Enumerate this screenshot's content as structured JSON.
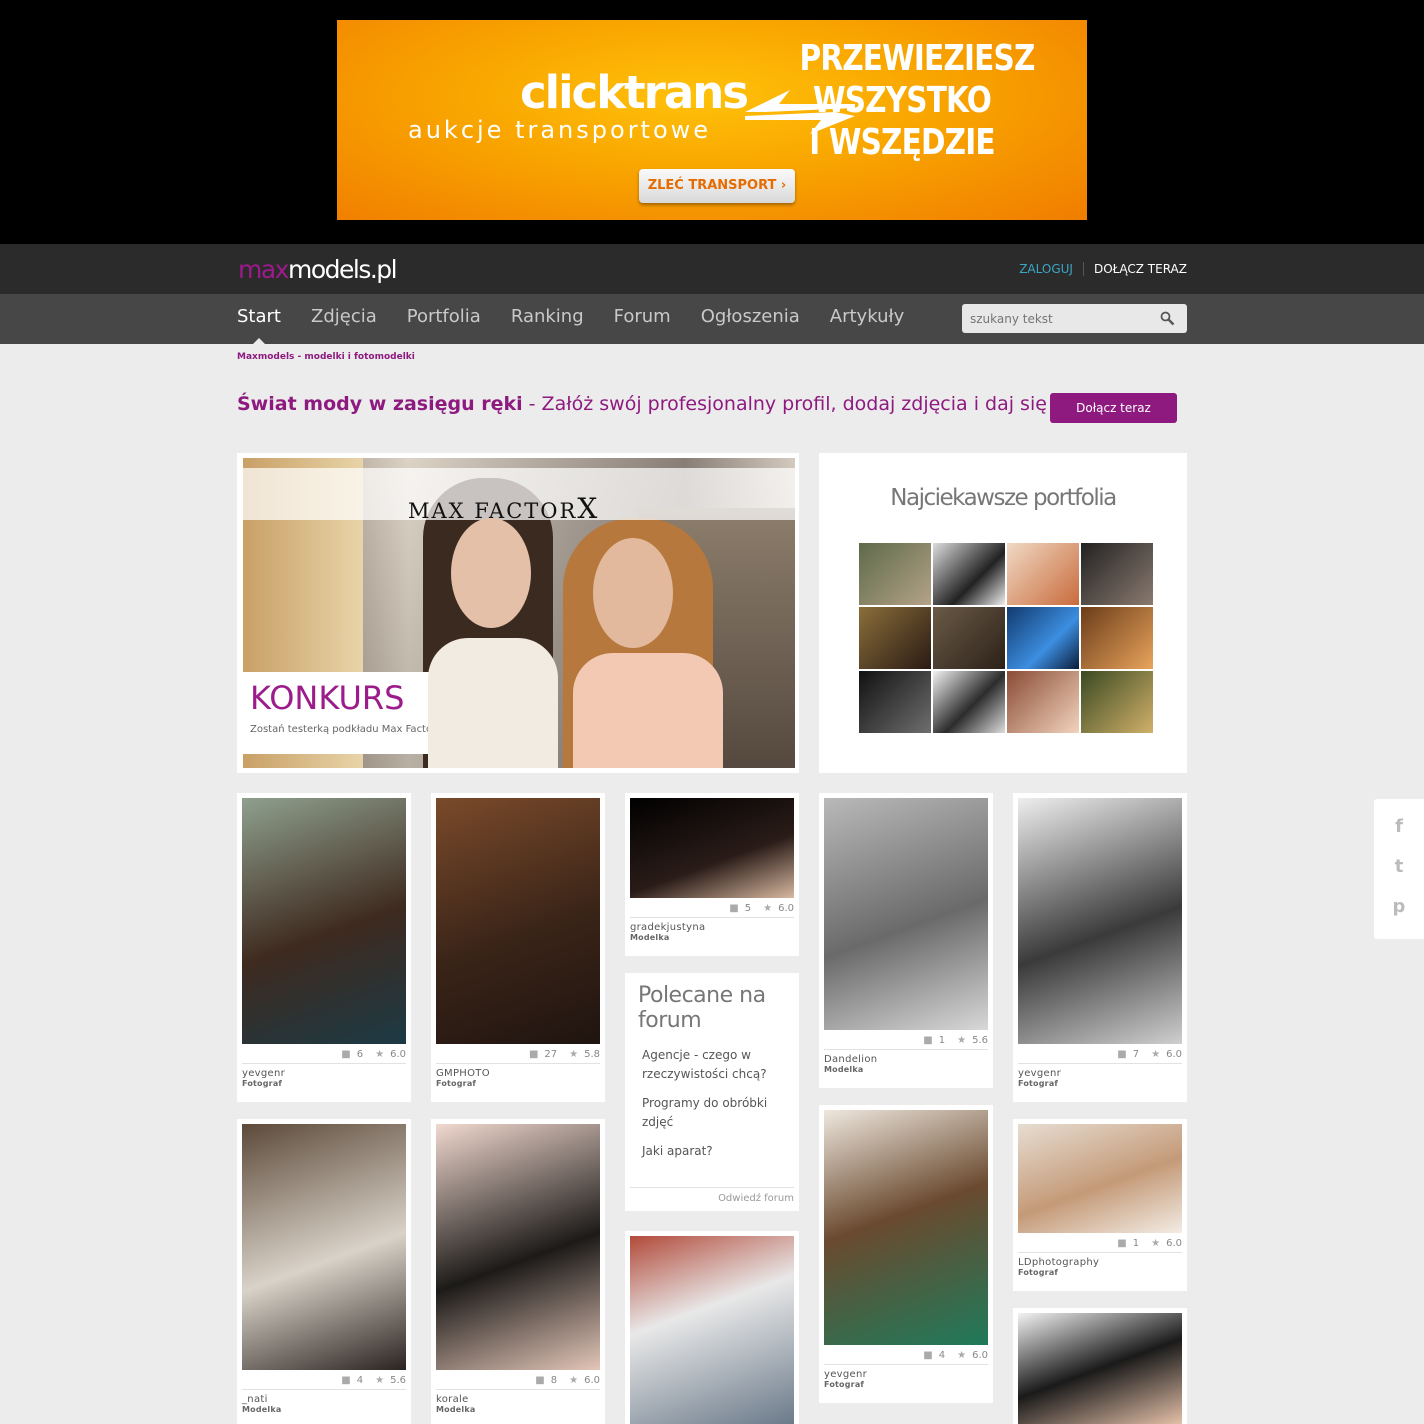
{
  "ad": {
    "brand": "clicktrans",
    "subtitle": "aukcje transportowe",
    "headline_1": "PRZEWIEZIESZ",
    "headline_2": "WSZYSTKO",
    "headline_3": "I WSZĘDZIE",
    "button": "ZLEĆ TRANSPORT ›",
    "color_bg": "#f9a600"
  },
  "header": {
    "logo_max": "max",
    "logo_rest": "models.pl",
    "login": "ZALOGUJ",
    "join": "DOŁĄCZ TERAZ"
  },
  "nav": {
    "items": [
      "Start",
      "Zdjęcia",
      "Portfolia",
      "Ranking",
      "Forum",
      "Ogłoszenia",
      "Artykuły"
    ],
    "active": "Start",
    "search_placeholder": "szukany tekst"
  },
  "breadcrumb": "Maxmodels - modelki i fotomodelki",
  "hero": {
    "bold": "Świat mody w zasięgu ręki",
    "rest": " - Załóż swój profesjonalny profil, dodaj zdjęcia i daj się znaleźć!",
    "button": "Dołącz teraz"
  },
  "konkurs": {
    "logo": "MAX FACTOR",
    "logo_x": "X",
    "title": "KONKURS",
    "description": "Zostań testerką podkładu Max Factor"
  },
  "portfolios": {
    "title": "Najciekawsze portfolia",
    "count": 12
  },
  "social": [
    "f",
    "t",
    "p"
  ],
  "cards": [
    {
      "comments": "6",
      "rating": "6.0",
      "user": "yevgenr",
      "role": "Fotograf"
    },
    {
      "comments": "27",
      "rating": "5.8",
      "user": "GMPHOTO",
      "role": "Fotograf"
    },
    {
      "comments": "5",
      "rating": "6.0",
      "user": "gradekjustyna",
      "role": "Modelka"
    },
    {
      "comments": "1",
      "rating": "5.6",
      "user": "Dandelion",
      "role": "Modelka"
    },
    {
      "comments": "7",
      "rating": "6.0",
      "user": "yevgenr",
      "role": "Fotograf"
    },
    {
      "comments": "4",
      "rating": "5.6",
      "user": "_nati",
      "role": "Modelka"
    },
    {
      "comments": "8",
      "rating": "6.0",
      "user": "korale",
      "role": "Modelka"
    },
    {
      "comments": "4",
      "rating": "6.0",
      "user": "yevgenr",
      "role": "Fotograf"
    },
    {
      "comments": "1",
      "rating": "6.0",
      "user": "LDphotography",
      "role": "Fotograf"
    }
  ],
  "forum": {
    "title": "Polecane na forum",
    "topics": [
      "Agencje - czego w rzeczywistości chcą?",
      "Programy do obróbki zdjęć",
      "Jaki aparat?"
    ],
    "footer": "Odwiedź forum"
  },
  "colors": {
    "accent": "#8e1a80",
    "topbar": "#2b2b2b",
    "navbar": "#474747",
    "login_link": "#3ba6c4"
  }
}
